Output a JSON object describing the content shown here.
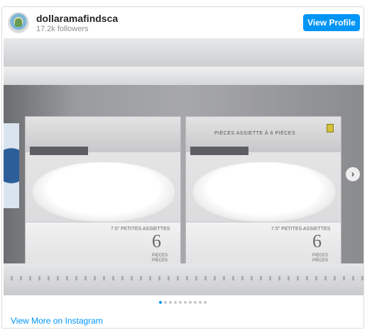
{
  "header": {
    "username": "dollaramafindsca",
    "followers": "17.2k followers",
    "view_profile": "View Profile"
  },
  "post": {
    "box_left": {
      "small_text": "7.5\" PETITES ASSIETTES",
      "count": "6",
      "pieces": "PIECES PIÈCES"
    },
    "box_right": {
      "top_text": "PIÈCES ASSIETTE À 6 PIÈCES",
      "small_text": "7.5\" PETITES ASSIETTES",
      "count": "6",
      "pieces": "PIECES PIÈCES"
    },
    "next_icon": "chevron-right-icon",
    "carousel": {
      "total": 10,
      "active_index": 0
    }
  },
  "footer": {
    "link": "View More on Instagram"
  },
  "colors": {
    "accent": "#0095f6",
    "text": "#262626",
    "muted": "#8e8e8e"
  }
}
